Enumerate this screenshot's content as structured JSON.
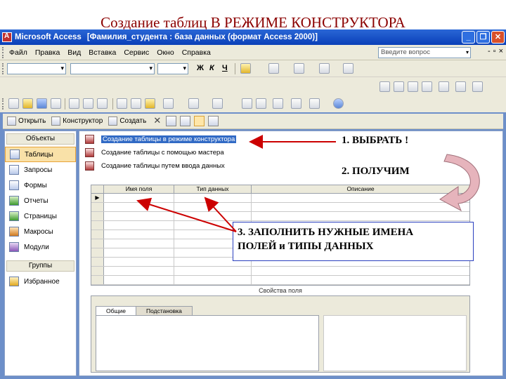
{
  "slide": {
    "title": "Создание таблиц В РЕЖИМЕ КОНСТРУКТОРА"
  },
  "window": {
    "app_name": "Microsoft Access",
    "doc_title": "[Фамилия_студента : база данных (формат Access 2000)]",
    "controls": [
      "_",
      "❐",
      "✕"
    ]
  },
  "menu": {
    "items": [
      "Файл",
      "Правка",
      "Вид",
      "Вставка",
      "Сервис",
      "Окно",
      "Справка"
    ],
    "question_placeholder": "Введите вопрос",
    "mini_controls": [
      "-",
      "▫",
      "×"
    ]
  },
  "format_toolbar": {
    "bold": "Ж",
    "italic": "К",
    "underline": "Ч"
  },
  "db_toolbar": {
    "open": "Открыть",
    "design": "Конструктор",
    "create": "Создать"
  },
  "objects_pane": {
    "objects_header": "Объекты",
    "items": [
      {
        "label": "Таблицы",
        "icon": "table-icon"
      },
      {
        "label": "Запросы",
        "icon": "query-icon"
      },
      {
        "label": "Формы",
        "icon": "form-icon"
      },
      {
        "label": "Отчеты",
        "icon": "report-icon"
      },
      {
        "label": "Страницы",
        "icon": "page-icon"
      },
      {
        "label": "Макросы",
        "icon": "macro-icon"
      },
      {
        "label": "Модули",
        "icon": "module-icon"
      }
    ],
    "groups_header": "Группы",
    "favorites": "Избранное"
  },
  "create_list": [
    {
      "label": "Создание таблицы в режиме конструктора",
      "selected": true
    },
    {
      "label": "Создание таблицы с помощью мастера",
      "selected": false
    },
    {
      "label": "Создание таблицы путем ввода данных",
      "selected": false
    }
  ],
  "design_grid": {
    "columns": [
      "Имя поля",
      "Тип данных",
      "Описание"
    ],
    "current_row_marker": "▶",
    "row_count": 10
  },
  "properties": {
    "title": "Свойства поля",
    "tabs": [
      "Общие",
      "Подстановка"
    ]
  },
  "annotations": {
    "step1": "1. ВЫБРАТЬ !",
    "step2": "2. ПОЛУЧИМ",
    "step3_line1": "3. ЗАПОЛНИТЬ НУЖНЫЕ ИМЕНА",
    "step3_line2": "ПОЛЕЙ и ТИПЫ ДАННЫХ"
  },
  "colors": {
    "title_red": "#8b0000",
    "titlebar_blue": "#0a3fb8",
    "selection_blue": "#316ac5",
    "arrow_red": "#cc0000",
    "curved_arrow": "#e0b0b8"
  }
}
